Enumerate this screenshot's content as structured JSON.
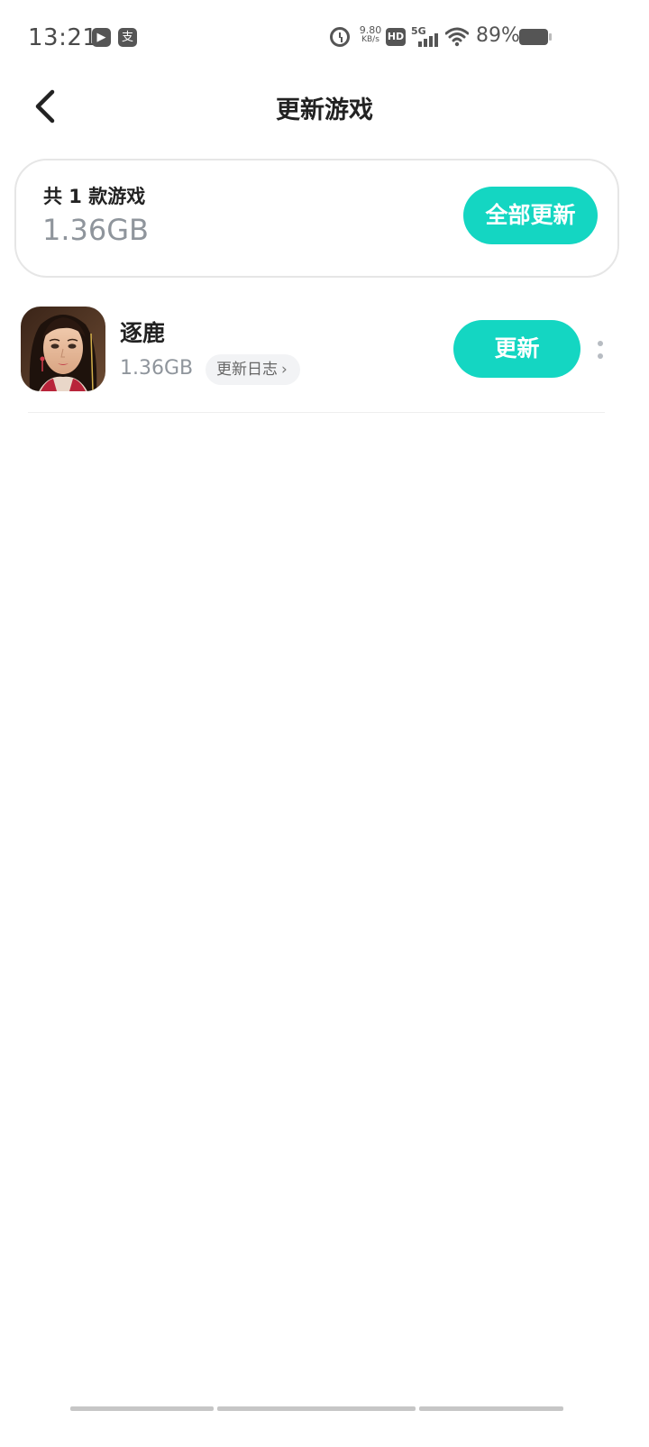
{
  "status_bar": {
    "time": "13:21",
    "app_icons": [
      "play-app-icon",
      "alipay-icon"
    ],
    "speed_value": "9.80",
    "speed_unit": "KB/s",
    "hd_label": "HD",
    "network_label": "5G",
    "battery_percent": "89%",
    "battery_level": 0.89
  },
  "header": {
    "title": "更新游戏",
    "back_icon": "back-arrow-icon"
  },
  "summary": {
    "count_text": "共 1 款游戏",
    "total_size": "1.36GB",
    "update_all_label": "全部更新"
  },
  "games": [
    {
      "name": "逐鹿",
      "size": "1.36GB",
      "changelog_label": "更新日志",
      "update_label": "更新"
    }
  ],
  "colors": {
    "accent": "#14d6c2",
    "muted_text": "#8f959c"
  }
}
